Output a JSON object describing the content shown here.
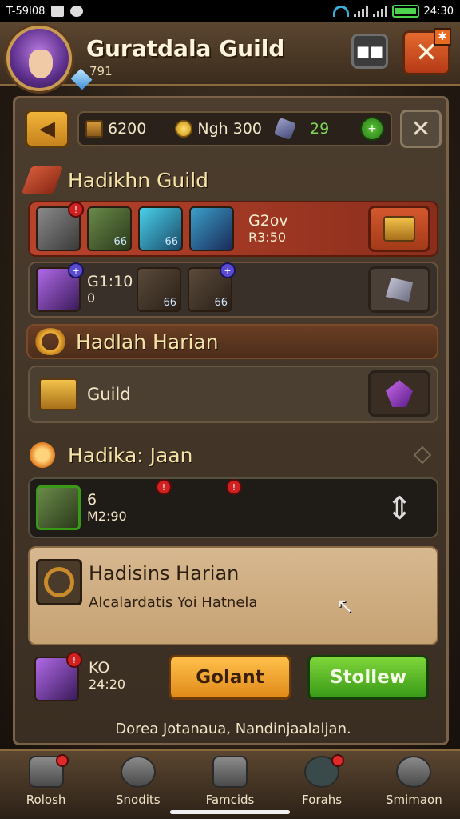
{
  "status_bar": {
    "time_left": "T-59I08",
    "time_right": "24:30"
  },
  "header": {
    "title": "Guratdala Guild",
    "subtitle": "791",
    "chat_icon_text": "■■",
    "close_corner": "✱"
  },
  "top_bar": {
    "back_glyph": "◀",
    "currencies": [
      {
        "icon": "crate-icon",
        "value": "6200"
      },
      {
        "icon": "coin-icon",
        "value": "Ngh 300"
      },
      {
        "icon": "ore-icon",
        "value": "29"
      }
    ],
    "plus_glyph": "+",
    "close_glyph": "✕"
  },
  "section1": {
    "title": "Hadikhn Guild"
  },
  "row1": {
    "items": [
      {
        "badge": "!"
      },
      {
        "label": "66"
      },
      {
        "label": "66"
      },
      {
        "label": ""
      }
    ],
    "name": "G2ov",
    "value": "R3:50"
  },
  "row2": {
    "item1_badge": "+",
    "text_top": "G1:10",
    "text_bottom": "0",
    "item2_label": "66",
    "item3_label": "66",
    "item3_badge": "+"
  },
  "section2": {
    "title": "Hadlah Harian"
  },
  "row3": {
    "label": "Guild"
  },
  "section3": {
    "title": "Hadika: Jaan"
  },
  "row4": {
    "count": "6",
    "time": "M2:90",
    "badge1": "!",
    "badge2": "!",
    "updown_glyph": "⇕"
  },
  "parchment": {
    "title": "Hadisins Harian",
    "text": "Alcalardatis Yoi Hatnela",
    "cursor_glyph": "↖"
  },
  "bottom_row": {
    "item_badge": "!",
    "count": "KO",
    "time": "24:20",
    "button_orange": "Golant",
    "button_green": "Stollew"
  },
  "footer_note": "Dorea Jotanaua, Nandinjaalaljan.",
  "nav": [
    {
      "label": "Rolosh"
    },
    {
      "label": "Snodits"
    },
    {
      "label": "Famcids"
    },
    {
      "label": "Forahs"
    },
    {
      "label": "Smimaon"
    }
  ]
}
